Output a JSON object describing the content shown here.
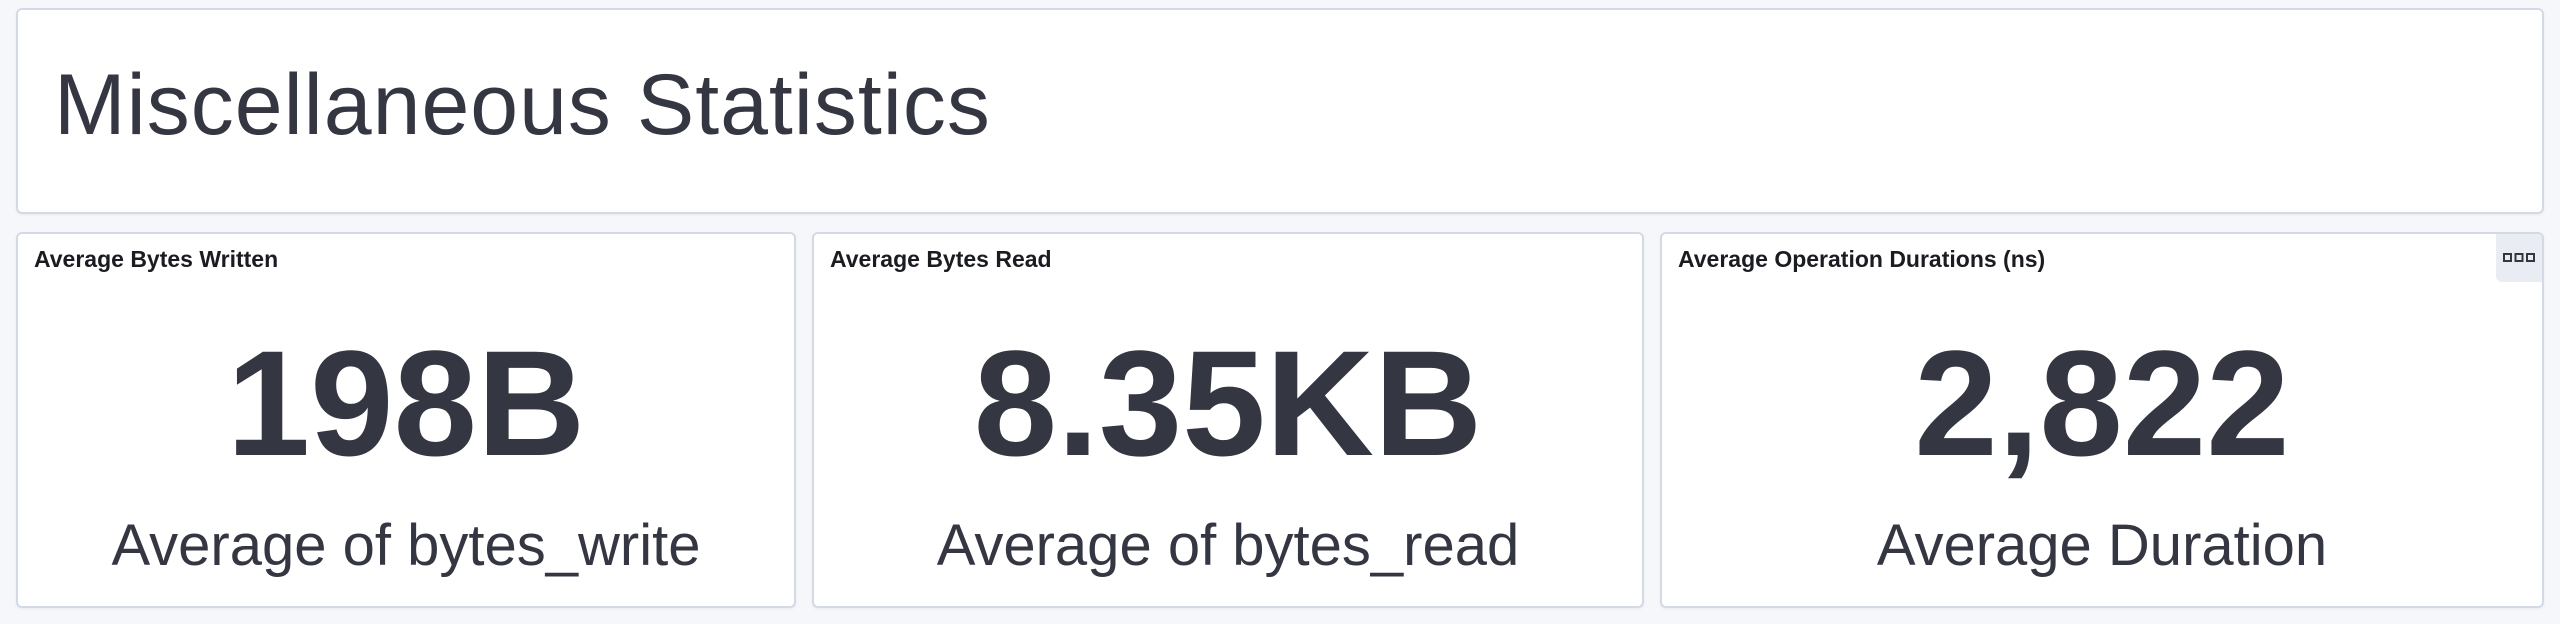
{
  "header": {
    "title": "Miscellaneous Statistics"
  },
  "panels": [
    {
      "title": "Average Bytes Written",
      "value": "198B",
      "label": "Average of bytes_write"
    },
    {
      "title": "Average Bytes Read",
      "value": "8.35KB",
      "label": "Average of bytes_read"
    },
    {
      "title": "Average Operation Durations (ns)",
      "value": "2,822",
      "label": "Average Duration",
      "options_icon": "ellipsis-icon"
    }
  ],
  "colors": {
    "text": "#343741",
    "panel_border": "#d3dae6",
    "background": "#f5f7fa",
    "panel_bg": "#ffffff"
  }
}
